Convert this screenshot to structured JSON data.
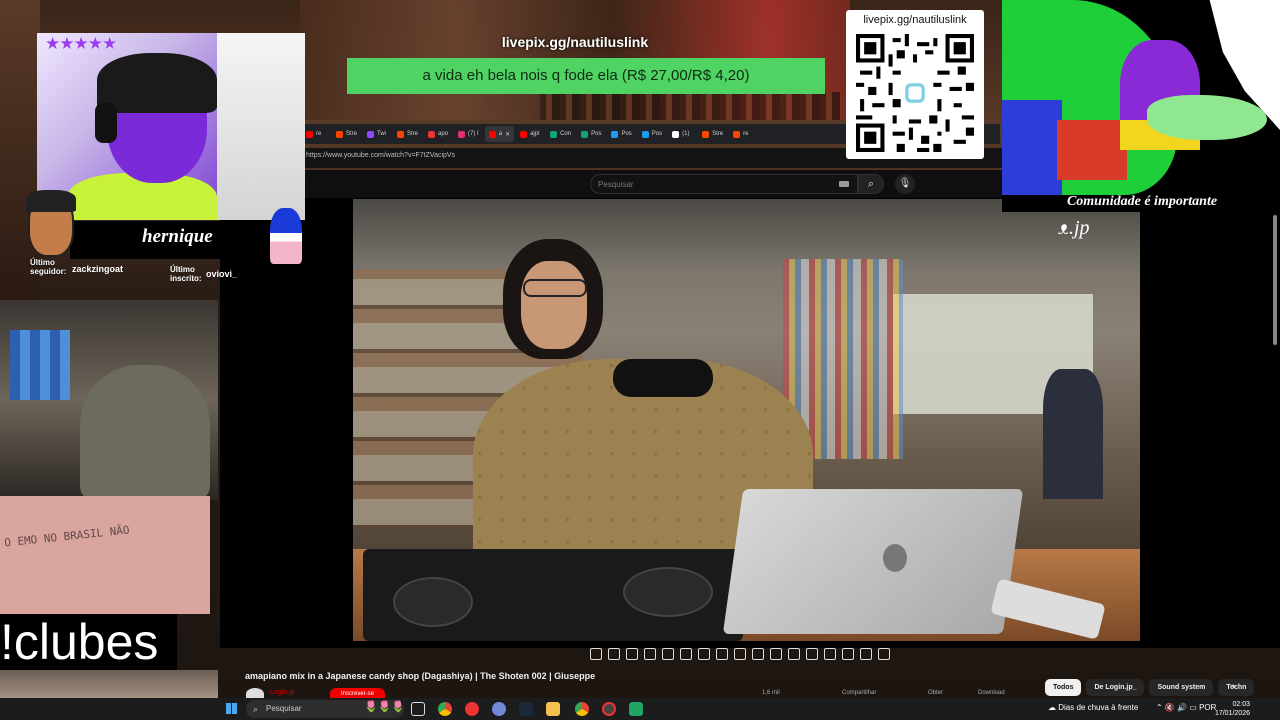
{
  "donation": {
    "url": "livepix.gg/nautiluslink",
    "message": "a vida eh bela nois q fode ela (R$ 27,00/R$ 4,20)"
  },
  "qr": {
    "label": "livepix.gg/nautiluslink"
  },
  "art": {
    "caption": "Comunidade é importante"
  },
  "webcam": {
    "stars": "★★★★★",
    "streamer_name": "hernique",
    "last_follower_label": "Último seguidor:",
    "last_follower": "zackzingoat",
    "last_subscriber_label": "Último inscrito:",
    "last_subscriber": "oviovi_"
  },
  "left": {
    "graffiti": "O EMO NO BRASIL NÃO",
    "command": "!clubes"
  },
  "browser": {
    "tabs": [
      {
        "label": "re",
        "icon": "red"
      },
      {
        "label": "Stre",
        "icon": "#ff4500"
      },
      {
        "label": "Twi",
        "icon": "#9146ff"
      },
      {
        "label": "Stre",
        "icon": "#ff4500"
      },
      {
        "label": "apo",
        "icon": "#e33"
      },
      {
        "label": "(7) I",
        "icon": "#e1306c"
      },
      {
        "label": "a",
        "icon": "#f00",
        "active": true
      },
      {
        "label": "ajpl",
        "icon": "#f00"
      },
      {
        "label": "Con",
        "icon": "#10a37f"
      },
      {
        "label": "Pos",
        "icon": "#10a37f"
      },
      {
        "label": "Pos",
        "icon": "#1d9bf0"
      },
      {
        "label": "Pos",
        "icon": "#1d9bf0"
      },
      {
        "label": "(1)",
        "icon": "#fff"
      },
      {
        "label": "Stre",
        "icon": "#ff4500"
      },
      {
        "label": "re",
        "icon": "#ff4500"
      }
    ],
    "url": "https://www.youtube.com/watch?v=F7tZVacipVs"
  },
  "youtube": {
    "search_placeholder": "Pesquisar",
    "video_logo": "ᴥ.jp",
    "video_title": "amapiano mix in a Japanese candy shop (Dagashiya) | The Shoten 002 | Giuseppe",
    "channel_name": "Login.jp",
    "subscribe_label": "Inscrever-se",
    "likes": "1,6 mil",
    "share": "Compartilhar",
    "thanks": "Obter",
    "download": "Download",
    "chips": [
      "Todos",
      "De Login.jp_",
      "Sound system",
      "Techn"
    ],
    "chips_active": 0
  },
  "taskbar": {
    "search_placeholder": "Pesquisar",
    "weather": "Dias de chuva à frente",
    "language": "POR",
    "time": "02:03",
    "date": "17/01/2026"
  },
  "colors": {
    "donation_bg": "#4fd464",
    "stars": "#9b3cf0",
    "youtube_red": "#e00"
  }
}
